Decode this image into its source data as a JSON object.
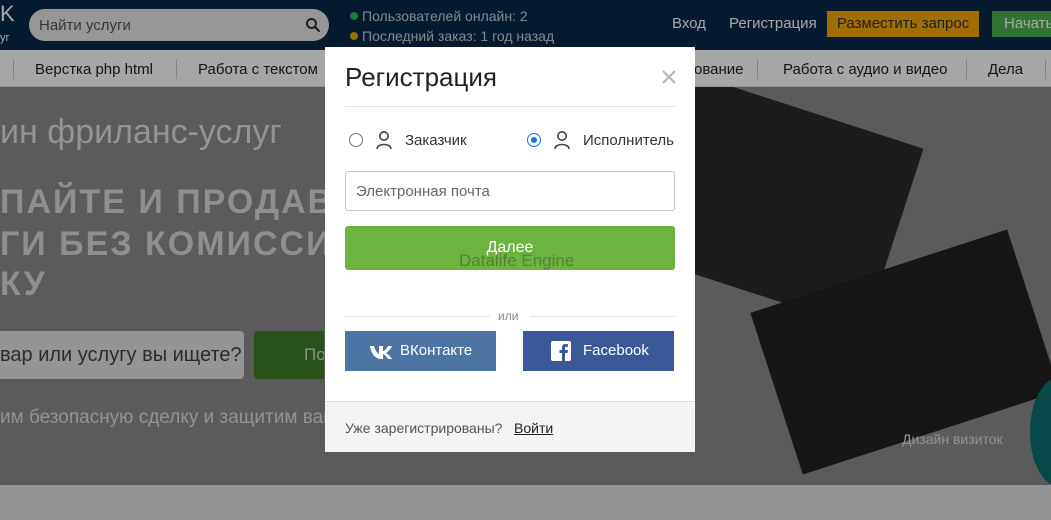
{
  "header": {
    "logo_fragment": "K",
    "logo_sub": "уг",
    "search_placeholder": "Найти услуги",
    "online_users": "Пользователей онлайн: 2",
    "last_order": "Последний заказ: 1 год назад",
    "login": "Вход",
    "register": "Регистрация",
    "post_request": "Разместить запрос",
    "start": "Начать",
    "colors": {
      "bg": "#0c2a4a",
      "accent_orange": "#f5a800",
      "accent_green": "#4caf50",
      "online_dot": "#22c55e",
      "order_dot": "#f5a800"
    }
  },
  "categories": [
    "Верстка php html",
    "Работа с текстом",
    "ование",
    "Работа с аудио и видео",
    "Дела"
  ],
  "hero": {
    "line1": "ин фриланс-услуг",
    "big1": "ПАЙТЕ И ПРОДАВ",
    "big2": "ГИ БЕЗ КОМИССИ",
    "big3": "КУ",
    "search_placeholder": "вар или услугу вы ищете?",
    "search_button": "По",
    "note": "им безопасную сделку и защитим ваши",
    "caption": "Дизайн визиток"
  },
  "modal": {
    "title": "Регистрация",
    "roles": [
      {
        "label": "Заказчик",
        "checked": false
      },
      {
        "label": "Исполнитель",
        "checked": true
      }
    ],
    "email_placeholder": "Электронная почта",
    "next_button": "Далее",
    "watermark": "Datalife Engine",
    "or": "или",
    "vk_button": "ВКонтакте",
    "fb_button": "Facebook",
    "footer_text": "Уже зарегистрированы?",
    "footer_link": "Войти",
    "colors": {
      "next": "#6db33f",
      "vk": "#4c75a3",
      "fb": "#3b5998"
    }
  }
}
